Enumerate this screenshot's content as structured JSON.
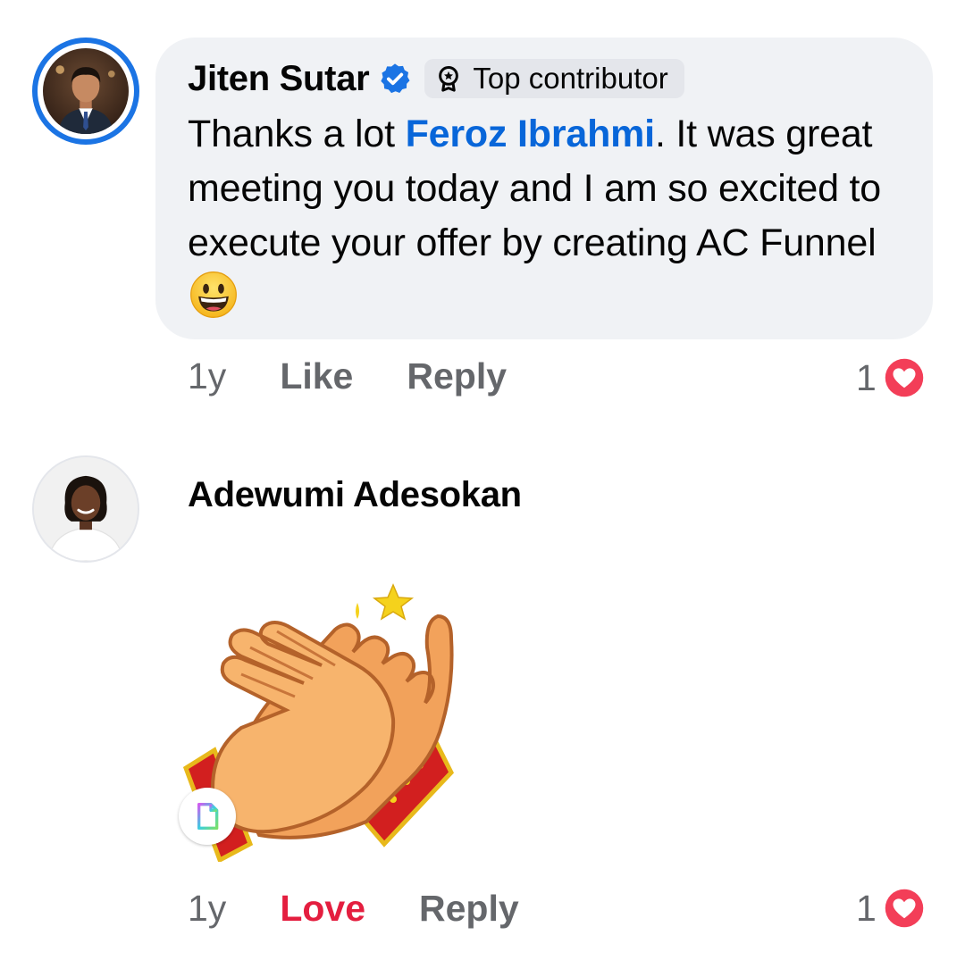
{
  "comment1": {
    "author": "Jiten Sutar",
    "badge": "Top contributor",
    "text_before": "Thanks a lot ",
    "mention": "Feroz Ibrahmi",
    "text_after": ". It was great meeting you today and I am so excited to execute your offer by creating AC Funnel",
    "emoji": "grinning-face",
    "time": "1y",
    "like_label": "Like",
    "reply_label": "Reply",
    "reaction_count": "1",
    "reaction_type": "love"
  },
  "comment2": {
    "author": "Adewumi Adesokan",
    "sticker": "clapping-hands-sticker",
    "time": "1y",
    "love_label": "Love",
    "reply_label": "Reply",
    "reaction_count": "1",
    "reaction_type": "love"
  },
  "colors": {
    "bubble": "#f0f2f5",
    "mention": "#0866d9",
    "verified": "#1b74e4",
    "love": "#e41e3f",
    "meta": "#65676b"
  }
}
